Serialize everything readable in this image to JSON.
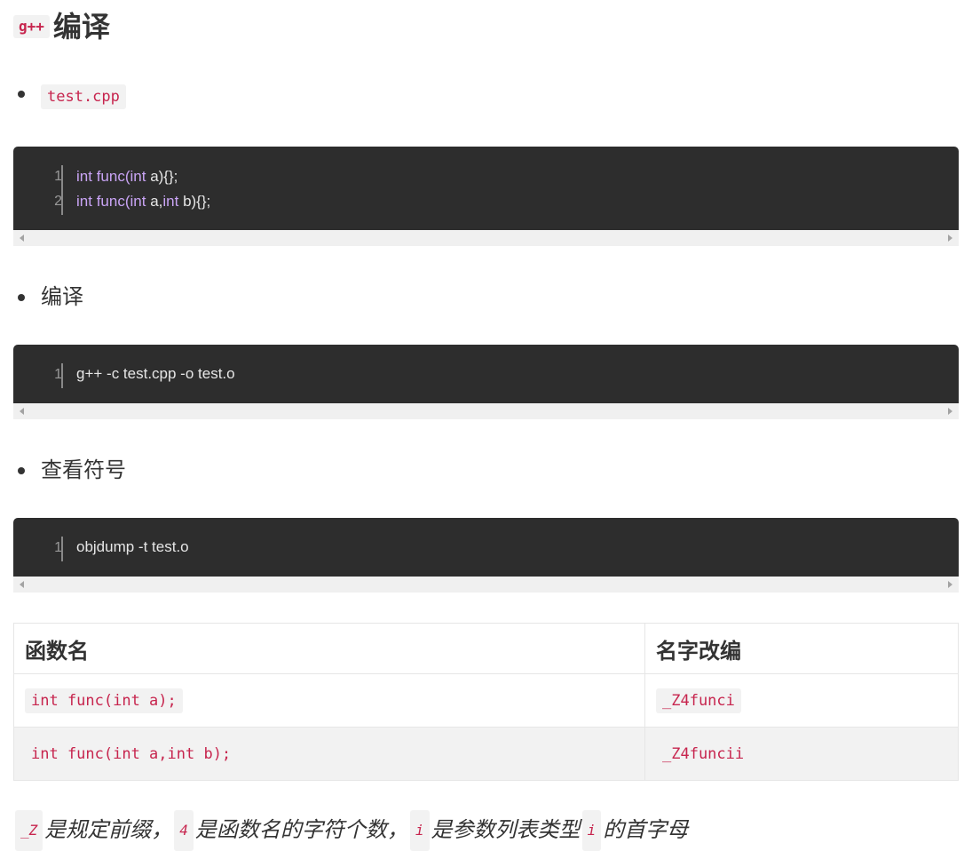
{
  "heading": {
    "code": "g++",
    "text": "编译"
  },
  "bullets": [
    {
      "code": "test.cpp"
    },
    {
      "text": "编译"
    },
    {
      "text": "查看符号"
    }
  ],
  "code_blocks": [
    {
      "lines": [
        {
          "num": "1",
          "parts": [
            "int",
            " func(",
            "int",
            " a){};"
          ]
        },
        {
          "num": "2",
          "parts": [
            "int",
            " func(",
            "int",
            " a,",
            "int",
            " b){};"
          ]
        }
      ]
    },
    {
      "lines": [
        {
          "num": "1",
          "text": "g++ -c test.cpp -o test.o"
        }
      ]
    },
    {
      "lines": [
        {
          "num": "1",
          "text": "objdump -t test.o"
        }
      ]
    }
  ],
  "table": {
    "headers": [
      "函数名",
      "名字改编"
    ],
    "rows": [
      [
        "int func(int a);",
        "_Z4funci"
      ],
      [
        "int func(int a,int b);",
        "_Z4funcii"
      ]
    ]
  },
  "note": {
    "code1": "_Z",
    "text1": "是规定前缀，",
    "code2": "4",
    "text2": "是函数名的字符个数，",
    "code3": "i",
    "text3": "是参数列表类型",
    "code4": "i",
    "text4": "的首字母"
  }
}
